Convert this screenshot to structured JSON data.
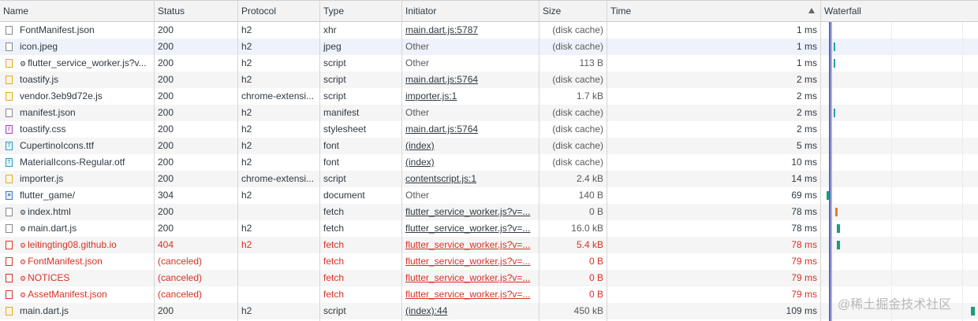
{
  "columns": [
    "Name",
    "Status",
    "Protocol",
    "Type",
    "Initiator",
    "Size",
    "Time",
    "Waterfall"
  ],
  "rows": [
    {
      "name": "FontManifest.json",
      "icon": "document-file-icon",
      "status": "200",
      "protocol": "h2",
      "type": "xhr",
      "initiator": "main.dart.js:5787",
      "initiator_link": true,
      "size": "(disk cache)",
      "time": "1 ms",
      "error": false,
      "gear": false
    },
    {
      "name": "icon.jpeg",
      "icon": "image-file-icon",
      "status": "200",
      "protocol": "h2",
      "type": "jpeg",
      "initiator": "Other",
      "initiator_link": false,
      "size": "(disk cache)",
      "time": "1 ms",
      "error": false,
      "gear": false
    },
    {
      "name": "flutter_service_worker.js?v...",
      "icon": "script-file-icon",
      "status": "200",
      "protocol": "h2",
      "type": "script",
      "initiator": "Other",
      "initiator_link": false,
      "size": "113 B",
      "time": "1 ms",
      "error": false,
      "gear": true
    },
    {
      "name": "toastify.js",
      "icon": "script-file-icon",
      "status": "200",
      "protocol": "h2",
      "type": "script",
      "initiator": "main.dart.js:5764",
      "initiator_link": true,
      "size": "(disk cache)",
      "time": "2 ms",
      "error": false,
      "gear": false
    },
    {
      "name": "vendor.3eb9d72e.js",
      "icon": "script-file-icon",
      "status": "200",
      "protocol": "chrome-extensi...",
      "type": "script",
      "initiator": "importer.js:1",
      "initiator_link": true,
      "size": "1.7 kB",
      "time": "2 ms",
      "error": false,
      "gear": false
    },
    {
      "name": "manifest.json",
      "icon": "document-file-icon",
      "status": "200",
      "protocol": "h2",
      "type": "manifest",
      "initiator": "Other",
      "initiator_link": false,
      "size": "(disk cache)",
      "time": "2 ms",
      "error": false,
      "gear": false
    },
    {
      "name": "toastify.css",
      "icon": "stylesheet-file-icon",
      "status": "200",
      "protocol": "h2",
      "type": "stylesheet",
      "initiator": "main.dart.js:5764",
      "initiator_link": true,
      "size": "(disk cache)",
      "time": "2 ms",
      "error": false,
      "gear": false
    },
    {
      "name": "CupertinoIcons.ttf",
      "icon": "font-file-icon",
      "status": "200",
      "protocol": "h2",
      "type": "font",
      "initiator": "(index)",
      "initiator_link": true,
      "size": "(disk cache)",
      "time": "5 ms",
      "error": false,
      "gear": false
    },
    {
      "name": "MaterialIcons-Regular.otf",
      "icon": "font-file-icon",
      "status": "200",
      "protocol": "h2",
      "type": "font",
      "initiator": "(index)",
      "initiator_link": true,
      "size": "(disk cache)",
      "time": "10 ms",
      "error": false,
      "gear": false
    },
    {
      "name": "importer.js",
      "icon": "script-file-icon",
      "status": "200",
      "protocol": "chrome-extensi...",
      "type": "script",
      "initiator": "contentscript.js:1",
      "initiator_link": true,
      "size": "2.4 kB",
      "time": "14 ms",
      "error": false,
      "gear": false
    },
    {
      "name": "flutter_game/",
      "icon": "html-document-icon",
      "status": "304",
      "protocol": "h2",
      "type": "document",
      "initiator": "Other",
      "initiator_link": false,
      "size": "140 B",
      "time": "69 ms",
      "error": false,
      "gear": false
    },
    {
      "name": "index.html",
      "icon": "document-file-icon",
      "status": "200",
      "protocol": "",
      "type": "fetch",
      "initiator": "flutter_service_worker.js?v=...",
      "initiator_link": true,
      "size": "0 B",
      "time": "78 ms",
      "error": false,
      "gear": true
    },
    {
      "name": "main.dart.js",
      "icon": "document-file-icon",
      "status": "200",
      "protocol": "h2",
      "type": "fetch",
      "initiator": "flutter_service_worker.js?v=...",
      "initiator_link": true,
      "size": "16.0 kB",
      "time": "78 ms",
      "error": false,
      "gear": true
    },
    {
      "name": "leitingting08.github.io",
      "icon": "error-file-icon",
      "status": "404",
      "protocol": "h2",
      "type": "fetch",
      "initiator": "flutter_service_worker.js?v=...",
      "initiator_link": true,
      "size": "5.4 kB",
      "time": "78 ms",
      "error": true,
      "gear": true
    },
    {
      "name": "FontManifest.json",
      "icon": "error-file-icon",
      "status": "(canceled)",
      "protocol": "",
      "type": "fetch",
      "initiator": "flutter_service_worker.js?v=...",
      "initiator_link": true,
      "size": "0 B",
      "time": "79 ms",
      "error": true,
      "gear": true
    },
    {
      "name": "NOTICES",
      "icon": "error-file-icon",
      "status": "(canceled)",
      "protocol": "",
      "type": "fetch",
      "initiator": "flutter_service_worker.js?v=...",
      "initiator_link": true,
      "size": "0 B",
      "time": "79 ms",
      "error": true,
      "gear": true
    },
    {
      "name": "AssetManifest.json",
      "icon": "error-file-icon",
      "status": "(canceled)",
      "protocol": "",
      "type": "fetch",
      "initiator": "flutter_service_worker.js?v=...",
      "initiator_link": true,
      "size": "0 B",
      "time": "79 ms",
      "error": true,
      "gear": true
    },
    {
      "name": "main.dart.js",
      "icon": "script-file-icon",
      "status": "200",
      "protocol": "h2",
      "type": "script",
      "initiator": "(index):44",
      "initiator_link": true,
      "size": "450 kB",
      "time": "109 ms",
      "error": false,
      "gear": false
    }
  ],
  "watermark": "@稀土掘金技术社区",
  "colors": {
    "error": "#d93025",
    "bar_blue": "#2b9bb5",
    "bar_teal": "#1a9c7a",
    "bar_orange": "#e8792b",
    "dom_line": "#3b6fd6",
    "load_line": "#d93025"
  }
}
